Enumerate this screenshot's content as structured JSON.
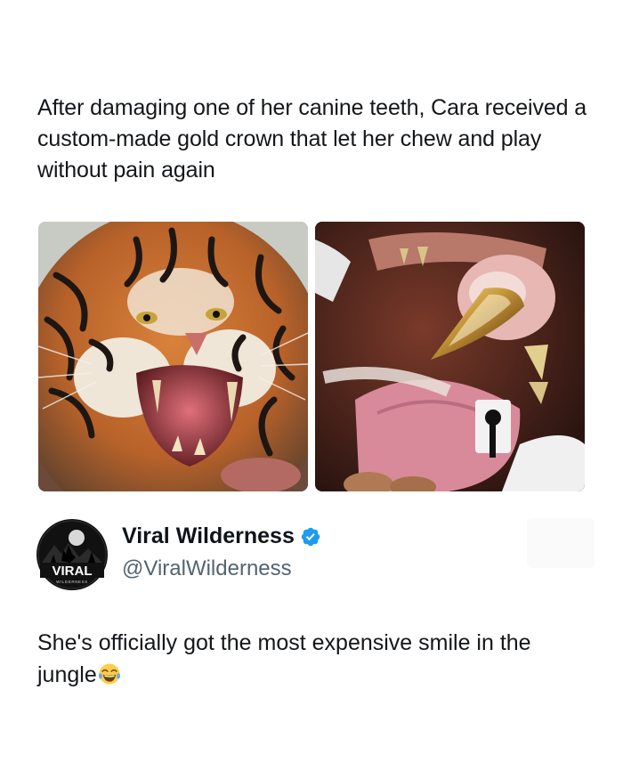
{
  "post": {
    "headline": "After damaging one of her canine teeth, Cara received a custom-made gold crown that let her chew and play without pain again",
    "images": [
      {
        "description_name": "snarling-tiger-photo"
      },
      {
        "description_name": "gold-crown-tooth-photo"
      }
    ]
  },
  "author": {
    "display_name": "Viral Wilderness",
    "handle": "@ViralWilderness",
    "avatar_label": "VIRAL",
    "avatar_sublabel": "WILDERNESS",
    "verified": true
  },
  "tweet": {
    "text": "She's officially got the most expensive smile in the jungle",
    "emoji": "face-with-tears-of-joy-icon"
  },
  "colors": {
    "verified_blue": "#1d9bf0",
    "handle_gray": "#536471",
    "text_dark": "#0f1419"
  }
}
